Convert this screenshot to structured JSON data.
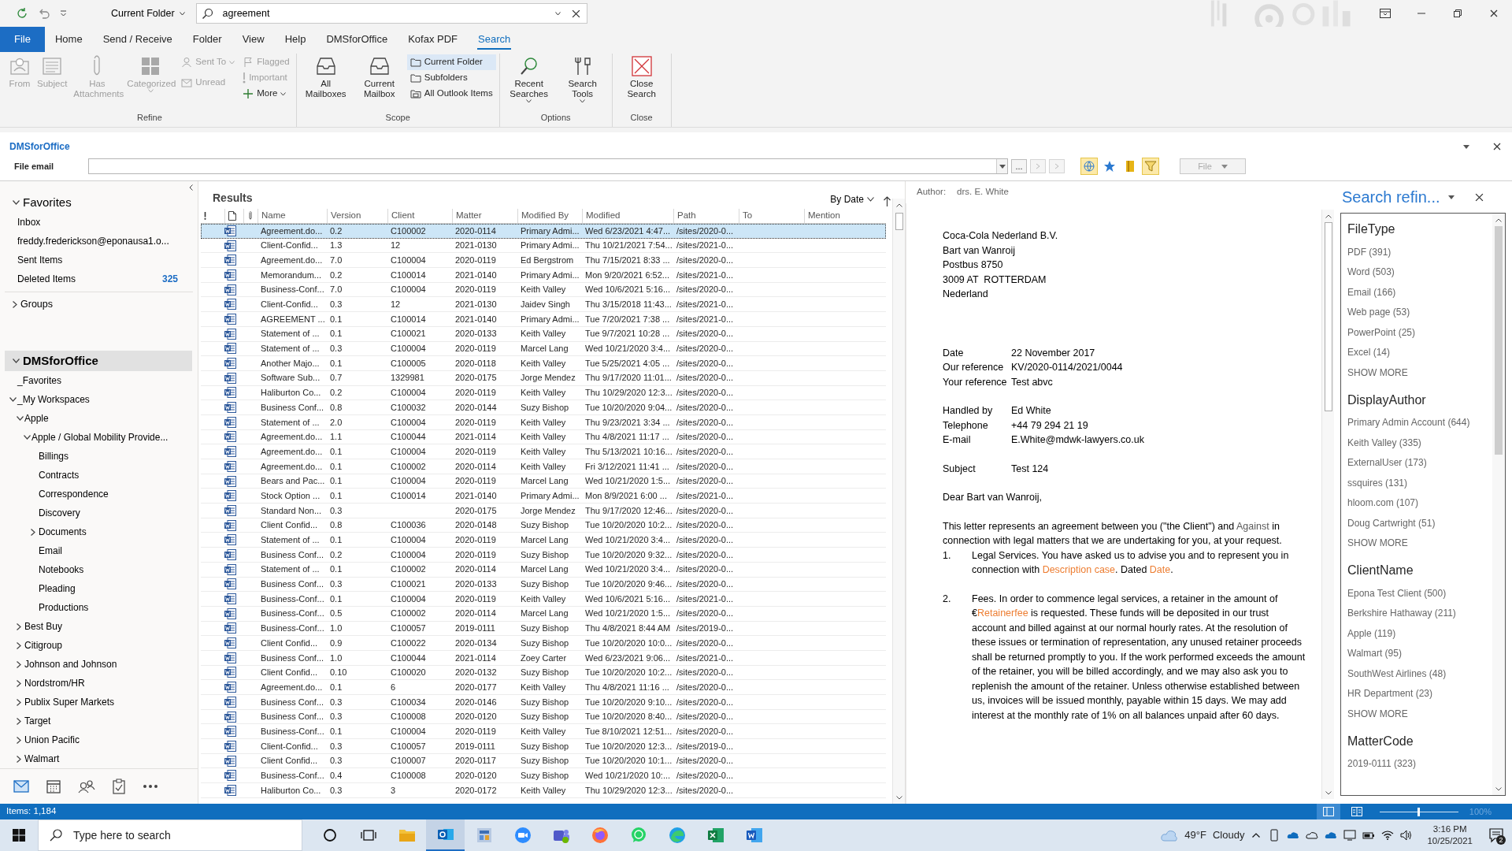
{
  "quick_access": {
    "scope": "Current Folder",
    "search_value": "agreement"
  },
  "ribbon": {
    "tabs": [
      {
        "label": "File",
        "kind": "file",
        "selected": false
      },
      {
        "label": "Home",
        "kind": "tab",
        "selected": false
      },
      {
        "label": "Send / Receive",
        "kind": "tab",
        "selected": false
      },
      {
        "label": "Folder",
        "kind": "tab",
        "selected": false
      },
      {
        "label": "View",
        "kind": "tab",
        "selected": false
      },
      {
        "label": "Help",
        "kind": "tab",
        "selected": false
      },
      {
        "label": "DMSforOffice",
        "kind": "tab",
        "selected": false
      },
      {
        "label": "Kofax PDF",
        "kind": "tab",
        "selected": false
      },
      {
        "label": "Search",
        "kind": "tab",
        "selected": true
      }
    ],
    "groups": [
      {
        "label": "Refine",
        "items": [
          {
            "kind": "large",
            "label": "From",
            "disabled": true
          },
          {
            "kind": "large",
            "label": "Subject",
            "disabled": true
          },
          {
            "kind": "large",
            "label": "Has Attachments",
            "disabled": true
          },
          {
            "kind": "large",
            "label": "Categorized",
            "disabled": true,
            "dropdown": true
          },
          {
            "kind": "stack",
            "buttons": [
              {
                "label": "Sent To",
                "disabled": true,
                "dropdown": true
              },
              {
                "label": "Unread",
                "disabled": true
              }
            ]
          },
          {
            "kind": "stack",
            "buttons": [
              {
                "label": "Flagged",
                "disabled": true
              },
              {
                "label": "Important",
                "disabled": true
              },
              {
                "label": "More",
                "disabled": false,
                "dropdown": true
              }
            ]
          }
        ]
      },
      {
        "label": "Scope",
        "items": [
          {
            "kind": "large",
            "label": "All Mailboxes",
            "selected": false
          },
          {
            "kind": "large",
            "label": "Current Mailbox",
            "selected": false
          },
          {
            "kind": "stack",
            "buttons": [
              {
                "label": "Current Folder",
                "selected": true
              },
              {
                "label": "Subfolders",
                "selected": false
              },
              {
                "label": "All Outlook Items",
                "selected": false
              }
            ]
          }
        ]
      },
      {
        "label": "Options",
        "items": [
          {
            "kind": "large",
            "label": "Recent Searches",
            "dropdown": true
          },
          {
            "kind": "large",
            "label": "Search Tools",
            "dropdown": true
          }
        ]
      },
      {
        "label": "Close",
        "items": [
          {
            "kind": "large",
            "label": "Close Search"
          }
        ]
      }
    ]
  },
  "dms_pane": {
    "title": "DMSforOffice",
    "field_label": "File email",
    "browse_label": "...",
    "file_button": "File"
  },
  "nav": {
    "sections": [
      {
        "title": "Favorites",
        "expanded": true,
        "selected": false,
        "items": [
          {
            "label": "Inbox"
          },
          {
            "label": "freddy.frederickson@eponausa1.o..."
          },
          {
            "label": "Sent Items"
          },
          {
            "label": "Deleted Items",
            "count": "325"
          }
        ]
      },
      {
        "title": "Groups",
        "expanded": false,
        "selected": false
      },
      {
        "title": "DMSforOffice",
        "expanded": true,
        "selected": true,
        "children": [
          {
            "label": "_Favorites"
          },
          {
            "label": "_My Workspaces",
            "expanded": true,
            "children": [
              {
                "label": "Apple",
                "expanded": true,
                "children": [
                  {
                    "label": "Apple / Global Mobility Provide...",
                    "expanded": true,
                    "children": [
                      {
                        "label": "Billings"
                      },
                      {
                        "label": "Contracts"
                      },
                      {
                        "label": "Correspondence"
                      },
                      {
                        "label": "Discovery"
                      },
                      {
                        "label": "Documents",
                        "expanded": false
                      },
                      {
                        "label": "Email"
                      },
                      {
                        "label": "Notebooks"
                      },
                      {
                        "label": "Pleading"
                      },
                      {
                        "label": "Productions"
                      }
                    ]
                  }
                ]
              },
              {
                "label": "Best Buy",
                "expanded": false
              },
              {
                "label": "Citigroup",
                "expanded": false
              },
              {
                "label": "Johnson and Johnson",
                "expanded": false
              },
              {
                "label": "Nordstrom/HR",
                "expanded": false
              },
              {
                "label": "Publix Super Markets",
                "expanded": false
              },
              {
                "label": "Target",
                "expanded": false
              },
              {
                "label": "Union Pacific",
                "expanded": false
              },
              {
                "label": "Walmart",
                "expanded": false
              }
            ]
          }
        ]
      }
    ],
    "bottom_buttons": [
      {
        "selected": true
      },
      {
        "selected": false
      },
      {
        "selected": false
      },
      {
        "selected": false
      },
      {
        "selected": false
      }
    ]
  },
  "results": {
    "title": "Results",
    "sort": "By Date",
    "columns": [
      "Name",
      "Version",
      "Client",
      "Matter",
      "Modified By",
      "Modified",
      "Path",
      "To",
      "Mention"
    ],
    "rows": [
      {
        "name": "Agreement.do...",
        "version": "0.2",
        "client": "C100002",
        "matter": "2020-0114",
        "modified_by": "Primary Admi...",
        "modified": "Wed 6/23/2021 4:47...",
        "path": "/sites/2020-0...",
        "selected": true
      },
      {
        "name": "Client-Confid...",
        "version": "1.3",
        "client": "12",
        "matter": "2021-0130",
        "modified_by": "Primary Admi...",
        "modified": "Thu 10/21/2021 7:54...",
        "path": "/sites/2021-0...",
        "selected": false
      },
      {
        "name": "Agreement.do...",
        "version": "7.0",
        "client": "C100004",
        "matter": "2020-0119",
        "modified_by": "Ed Bergstrom",
        "modified": "Thu 7/15/2021 8:33 ...",
        "path": "/sites/2020-0...",
        "selected": false
      },
      {
        "name": "Memorandum...",
        "version": "0.2",
        "client": "C100014",
        "matter": "2021-0140",
        "modified_by": "Primary Admi...",
        "modified": "Mon 9/20/2021 6:52...",
        "path": "/sites/2021-0...",
        "selected": false
      },
      {
        "name": "Business-Conf...",
        "version": "7.0",
        "client": "C100004",
        "matter": "2020-0119",
        "modified_by": "Keith Valley",
        "modified": "Wed 10/6/2021 5:16...",
        "path": "/sites/2020-0...",
        "selected": false
      },
      {
        "name": "Client-Confid...",
        "version": "0.3",
        "client": "12",
        "matter": "2021-0130",
        "modified_by": "Jaidev Singh",
        "modified": "Thu 3/15/2018 11:43...",
        "path": "/sites/2021-0...",
        "selected": false
      },
      {
        "name": "AGREEMENT ...",
        "version": "0.1",
        "client": "C100014",
        "matter": "2021-0140",
        "modified_by": "Primary Admi...",
        "modified": "Tue 7/20/2021 7:38 ...",
        "path": "/sites/2021-0...",
        "selected": false
      },
      {
        "name": "Statement of ...",
        "version": "0.1",
        "client": "C100021",
        "matter": "2020-0133",
        "modified_by": "Keith Valley",
        "modified": "Tue 9/7/2021 10:28 ...",
        "path": "/sites/2020-0...",
        "selected": false
      },
      {
        "name": "Statement of ...",
        "version": "0.3",
        "client": "C100004",
        "matter": "2020-0119",
        "modified_by": "Marcel Lang",
        "modified": "Wed 10/21/2020 3:4...",
        "path": "/sites/2020-0...",
        "selected": false
      },
      {
        "name": "Another Majo...",
        "version": "0.1",
        "client": "C100005",
        "matter": "2020-0118",
        "modified_by": "Keith Valley",
        "modified": "Tue 5/25/2021 4:05 ...",
        "path": "/sites/2020-0...",
        "selected": false
      },
      {
        "name": "Software Sub...",
        "version": "0.7",
        "client": "1329981",
        "matter": "2020-0175",
        "modified_by": "Jorge Mendez",
        "modified": "Thu 9/17/2020 11:01...",
        "path": "/sites/2020-0...",
        "selected": false
      },
      {
        "name": "Haliburton Co...",
        "version": "0.2",
        "client": "C100004",
        "matter": "2020-0119",
        "modified_by": "Keith Valley",
        "modified": "Thu 10/29/2020 12:3...",
        "path": "/sites/2020-0...",
        "selected": false
      },
      {
        "name": "Business Conf...",
        "version": "0.8",
        "client": "C100032",
        "matter": "2020-0144",
        "modified_by": "Suzy Bishop",
        "modified": "Tue 10/20/2020 9:04...",
        "path": "/sites/2020-0...",
        "selected": false
      },
      {
        "name": "Statement of ...",
        "version": "2.0",
        "client": "C100004",
        "matter": "2020-0119",
        "modified_by": "Keith Valley",
        "modified": "Thu 9/23/2021 3:34 ...",
        "path": "/sites/2020-0...",
        "selected": false
      },
      {
        "name": "Agreement.do...",
        "version": "1.1",
        "client": "C100044",
        "matter": "2021-0114",
        "modified_by": "Keith Valley",
        "modified": "Thu 4/8/2021 11:17 ...",
        "path": "/sites/2020-0...",
        "selected": false
      },
      {
        "name": "Agreement.do...",
        "version": "0.1",
        "client": "C100004",
        "matter": "2020-0119",
        "modified_by": "Keith Valley",
        "modified": "Thu 5/13/2021 10:16...",
        "path": "/sites/2020-0...",
        "selected": false
      },
      {
        "name": "Agreement.do...",
        "version": "0.1",
        "client": "C100002",
        "matter": "2020-0114",
        "modified_by": "Keith Valley",
        "modified": "Fri 3/12/2021 11:41 ...",
        "path": "/sites/2020-0...",
        "selected": false
      },
      {
        "name": "Bears and Pac...",
        "version": "0.1",
        "client": "C100004",
        "matter": "2020-0119",
        "modified_by": "Marcel Lang",
        "modified": "Wed 10/21/2020 1:5...",
        "path": "/sites/2020-0...",
        "selected": false
      },
      {
        "name": "Stock Option ...",
        "version": "0.1",
        "client": "C100014",
        "matter": "2021-0140",
        "modified_by": "Primary Admi...",
        "modified": "Mon 8/9/2021 6:00 ...",
        "path": "/sites/2021-0...",
        "selected": false
      },
      {
        "name": "Standard Non...",
        "version": "0.3",
        "matter": "2020-0175",
        "modified_by": "Jorge Mendez",
        "modified": "Thu 9/17/2020 12:46...",
        "path": "/sites/2020-0...",
        "selected": false
      },
      {
        "name": "Client Confid...",
        "version": "0.8",
        "client": "C100036",
        "matter": "2020-0148",
        "modified_by": "Suzy Bishop",
        "modified": "Tue 10/20/2020 10:2...",
        "path": "/sites/2020-0...",
        "selected": false
      },
      {
        "name": "Statement of ...",
        "version": "0.1",
        "client": "C100004",
        "matter": "2020-0119",
        "modified_by": "Marcel Lang",
        "modified": "Wed 10/21/2020 3:4...",
        "path": "/sites/2020-0...",
        "selected": false
      },
      {
        "name": "Business Conf...",
        "version": "0.2",
        "client": "C100004",
        "matter": "2020-0119",
        "modified_by": "Suzy Bishop",
        "modified": "Tue 10/20/2020 9:32...",
        "path": "/sites/2020-0...",
        "selected": false
      },
      {
        "name": "Statement of ...",
        "version": "0.1",
        "client": "C100002",
        "matter": "2020-0114",
        "modified_by": "Marcel Lang",
        "modified": "Wed 10/21/2020 3:4...",
        "path": "/sites/2020-0...",
        "selected": false
      },
      {
        "name": "Business Conf...",
        "version": "0.3",
        "client": "C100021",
        "matter": "2020-0133",
        "modified_by": "Suzy Bishop",
        "modified": "Tue 10/20/2020 9:46...",
        "path": "/sites/2020-0...",
        "selected": false
      },
      {
        "name": "Business-Conf...",
        "version": "0.1",
        "client": "C100004",
        "matter": "2020-0119",
        "modified_by": "Keith Valley",
        "modified": "Wed 10/6/2021 5:16...",
        "path": "/sites/2021-0...",
        "selected": false
      },
      {
        "name": "Business-Conf...",
        "version": "0.5",
        "client": "C100002",
        "matter": "2020-0114",
        "modified_by": "Marcel Lang",
        "modified": "Wed 10/21/2020 1:5...",
        "path": "/sites/2020-0...",
        "selected": false
      },
      {
        "name": "Business-Conf...",
        "version": "1.0",
        "client": "C100057",
        "matter": "2019-0111",
        "modified_by": "Suzy Bishop",
        "modified": "Thu 4/8/2021 8:44 AM",
        "path": "/sites/2019-0...",
        "selected": false
      },
      {
        "name": "Client Confid...",
        "version": "0.9",
        "client": "C100022",
        "matter": "2020-0134",
        "modified_by": "Suzy Bishop",
        "modified": "Tue 10/20/2020 10:0...",
        "path": "/sites/2020-0...",
        "selected": false
      },
      {
        "name": "Business Conf...",
        "version": "1.0",
        "client": "C100044",
        "matter": "2021-0114",
        "modified_by": "Zoey Carter",
        "modified": "Wed 6/23/2021 9:06...",
        "path": "/sites/2021-0...",
        "selected": false
      },
      {
        "name": "Client Confid...",
        "version": "0.10",
        "client": "C100020",
        "matter": "2020-0132",
        "modified_by": "Suzy Bishop",
        "modified": "Tue 10/20/2020 10:2...",
        "path": "/sites/2020-0...",
        "selected": false
      },
      {
        "name": "Agreement.do...",
        "version": "0.1",
        "client": "6",
        "matter": "2020-0177",
        "modified_by": "Keith Valley",
        "modified": "Thu 4/8/2021 11:16 ...",
        "path": "/sites/2020-0...",
        "selected": false
      },
      {
        "name": "Business Conf...",
        "version": "0.3",
        "client": "C100034",
        "matter": "2020-0146",
        "modified_by": "Suzy Bishop",
        "modified": "Tue 10/20/2020 9:10...",
        "path": "/sites/2020-0...",
        "selected": false
      },
      {
        "name": "Business Conf...",
        "version": "0.3",
        "client": "C100008",
        "matter": "2020-0120",
        "modified_by": "Suzy Bishop",
        "modified": "Tue 10/20/2020 8:40...",
        "path": "/sites/2020-0...",
        "selected": false
      },
      {
        "name": "Business-Conf...",
        "version": "0.1",
        "client": "C100004",
        "matter": "2020-0119",
        "modified_by": "Keith Valley",
        "modified": "Tue 8/10/2021 12:51...",
        "path": "/sites/2020-0...",
        "selected": false
      },
      {
        "name": "Client-Confid...",
        "version": "0.3",
        "client": "C100057",
        "matter": "2019-0111",
        "modified_by": "Suzy Bishop",
        "modified": "Tue 10/20/2020 12:3...",
        "path": "/sites/2019-0...",
        "selected": false
      },
      {
        "name": "Client Confid...",
        "version": "0.3",
        "client": "C100007",
        "matter": "2020-0117",
        "modified_by": "Suzy Bishop",
        "modified": "Tue 10/20/2020 10:1...",
        "path": "/sites/2020-0...",
        "selected": false
      },
      {
        "name": "Business-Conf...",
        "version": "0.4",
        "client": "C100008",
        "matter": "2020-0120",
        "modified_by": "Suzy Bishop",
        "modified": "Wed 10/21/2020 10:...",
        "path": "/sites/2020-0...",
        "selected": false
      },
      {
        "name": "Haliburton Co...",
        "version": "0.3",
        "client": "3",
        "matter": "2020-0172",
        "modified_by": "Keith Valley",
        "modified": "Thu 10/29/2020 12:3...",
        "path": "/sites/2020-0...",
        "selected": false
      }
    ]
  },
  "preview": {
    "author_label": "Author:",
    "author": "drs. E. White",
    "address": [
      "Coca-Cola Nederland B.V.",
      "Bart van Wanroij",
      "Postbus 8750",
      "3009 AT  ROTTERDAM",
      "Nederland"
    ],
    "field_groups": [
      {
        "fields": [
          {
            "label": "Date",
            "value": "22 November 2017"
          },
          {
            "label": "Our reference",
            "value": "KV/2020-0114/2021/0044"
          },
          {
            "label": "Your reference",
            "value": "Test abvc"
          }
        ]
      },
      {
        "fields": [
          {
            "label": "Handled by",
            "value": "Ed White"
          },
          {
            "label": "Telephone",
            "value": "+44 79 294 21 19"
          },
          {
            "label": "E-mail",
            "value": "E.White@mdwk-lawyers.co.uk"
          }
        ]
      },
      {
        "fields": [
          {
            "label": "Subject",
            "value": "Test 124"
          }
        ]
      }
    ],
    "salutation": "Dear Bart van Wanroij,",
    "intro": [
      {
        "text": "This letter represents an agreement between you (\"the Client\") and "
      },
      {
        "text": "Against",
        "kind": "muted"
      },
      {
        "text": " in connection with legal matters that we are undertaking for you, at your request."
      }
    ],
    "items": [
      {
        "number": "1.",
        "parts": [
          {
            "text": "Legal Services. You have asked us to advise you and to represent you in connection with "
          },
          {
            "text": "Description case",
            "kind": "field"
          },
          {
            "text": ". Dated "
          },
          {
            "text": "Date",
            "kind": "field"
          },
          {
            "text": "."
          }
        ]
      },
      {
        "number": "2.",
        "parts": [
          {
            "text": "Fees. In order to commence legal services, a retainer in the amount of €"
          },
          {
            "text": "Retainerfee",
            "kind": "field"
          },
          {
            "text": " is requested. These funds will be deposited in our trust account and billed against at our normal hourly rates. At the resolution of these issues or termination of representation, any unused retainer proceeds shall be returned promptly to you. If the work performed exceeds the amount of the retainer, you will be billed accordingly, and we may also ask you to replenish the amount of the retainer. Unless otherwise established between us, invoices will be issued monthly, payable within 15 days. We may add interest at the monthly rate of 1% on all balances unpaid after 60 days."
          }
        ]
      }
    ]
  },
  "refiner": {
    "title": "Search refin...",
    "groups": [
      {
        "title": "FileType",
        "items": [
          "PDF (391)",
          "Word (503)",
          "Email (166)",
          "Web page (53)",
          "PowerPoint (25)",
          "Excel (14)"
        ],
        "more": "SHOW MORE"
      },
      {
        "title": "DisplayAuthor",
        "items": [
          "Primary Admin Account (644)",
          "Keith Valley (335)",
          "ExternalUser (173)",
          "ssquires (131)",
          "hloom.com (107)",
          "Doug Cartwright (51)"
        ],
        "more": "SHOW MORE"
      },
      {
        "title": "ClientName",
        "items": [
          "Epona Test Client (500)",
          "Berkshire Hathaway (211)",
          "Apple (119)",
          "Walmart (95)",
          "SouthWest Airlines (48)",
          "HR Department (23)"
        ],
        "more": "SHOW MORE"
      },
      {
        "title": "MatterCode",
        "items": [
          "2019-0111 (323)"
        ]
      }
    ]
  },
  "status_bar": {
    "items": "Items: 1,184",
    "zoom": "100%",
    "zoom_slider": {
      "level": 0.5
    },
    "views": [
      {
        "selected": true
      },
      {
        "selected": false
      }
    ]
  },
  "taskbar": {
    "search_placeholder": "Type here to search",
    "buttons": [
      {
        "selected": false
      },
      {
        "selected": false
      },
      {
        "selected": false
      },
      {
        "selected": true
      },
      {
        "selected": false
      },
      {
        "selected": false
      },
      {
        "selected": false
      },
      {
        "selected": false
      },
      {
        "selected": false
      },
      {
        "selected": false
      },
      {
        "selected": false
      },
      {
        "selected": false
      }
    ],
    "temperature": "49°F",
    "weather": "Cloudy",
    "time": "3:16 PM",
    "date": "10/25/2021",
    "notifications": "2"
  }
}
